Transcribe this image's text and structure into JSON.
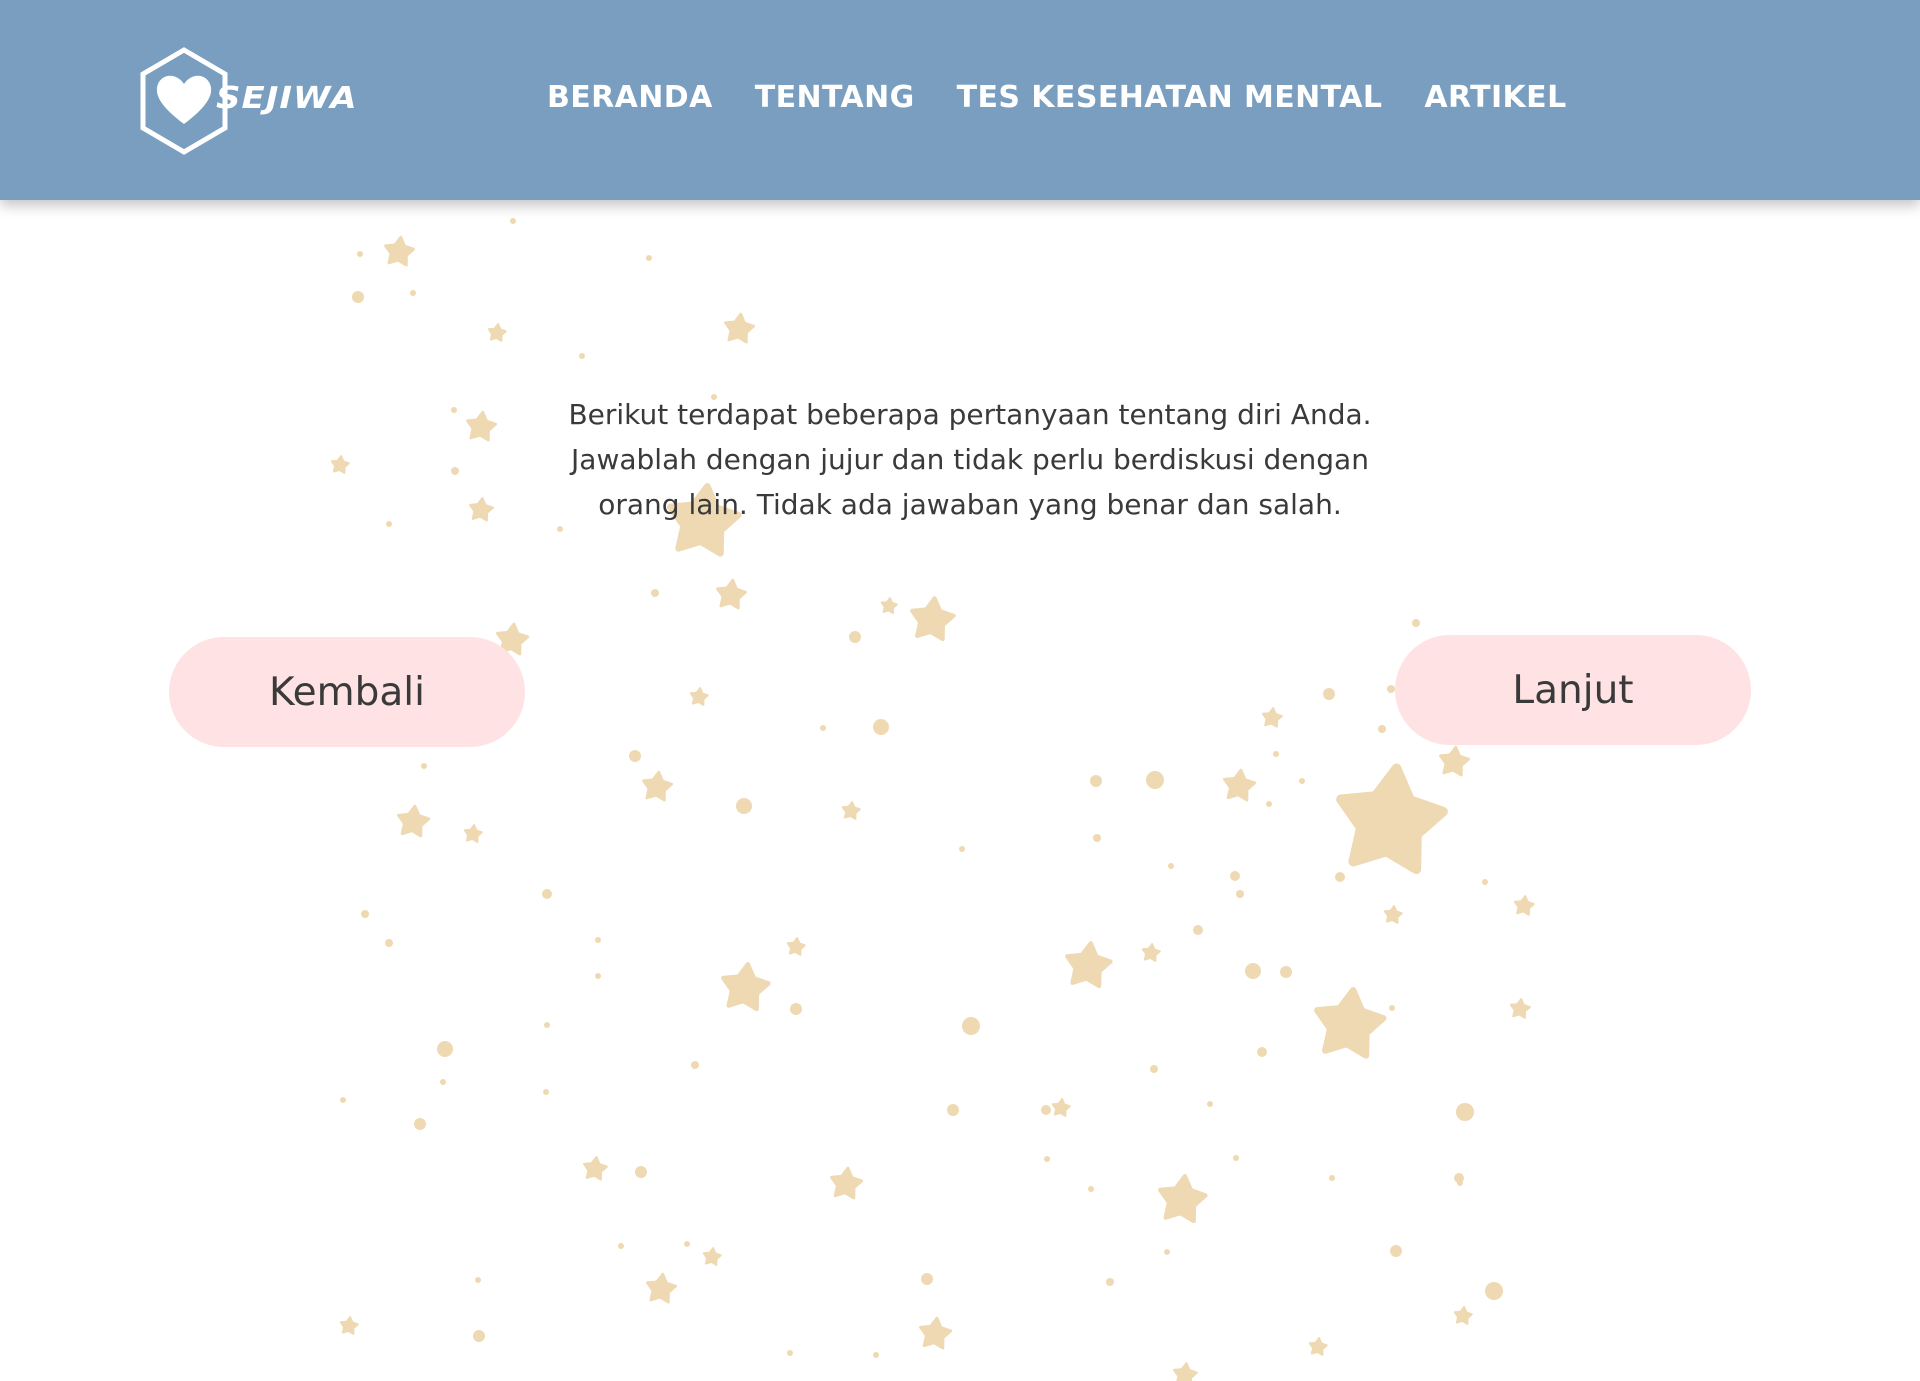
{
  "header": {
    "logo_text": "SEJIWA",
    "logo_icon": "heart-hexagon-icon",
    "nav": [
      {
        "label": "BERANDA"
      },
      {
        "label": "TENTANG"
      },
      {
        "label": "TES KESEHATAN MENTAL"
      },
      {
        "label": "ARTIKEL"
      }
    ]
  },
  "main": {
    "intro_lines": [
      "Berikut terdapat beberapa pertanyaan tentang diri Anda.",
      "Jawablah dengan jujur dan tidak perlu berdiskusi dengan",
      "orang lain. Tidak ada jawaban yang benar dan salah."
    ],
    "back_label": "Kembali",
    "next_label": "Lanjut"
  },
  "colors": {
    "navbar": "#799ebf",
    "button_bg": "#ffe2e3",
    "star": "#eed9b3",
    "text": "#3a3a3a"
  },
  "background_icon": "star-icon"
}
